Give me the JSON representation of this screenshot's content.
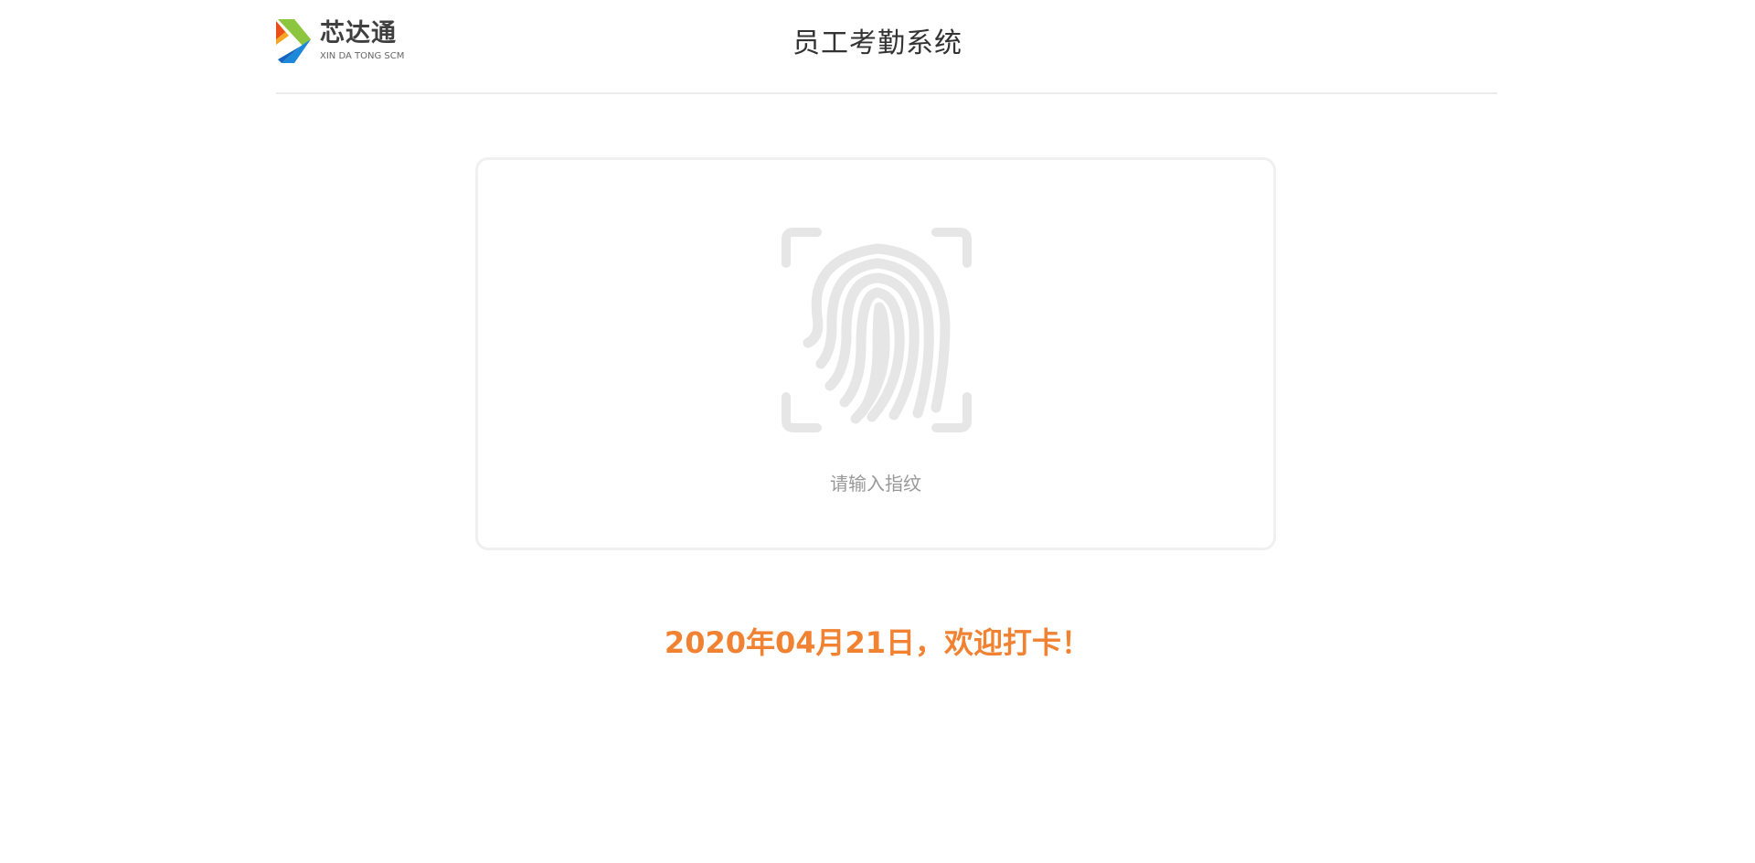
{
  "header": {
    "logo_cn": "芯达通",
    "logo_en": "XIN DA TONG SCM",
    "title": "员工考勤系统"
  },
  "scanner": {
    "icon": "fingerprint-icon",
    "prompt": "请输入指纹"
  },
  "welcome_message": "2020年04月21日，欢迎打卡！",
  "colors": {
    "accent": "#f08232",
    "fingerprint": "#e6e6e6",
    "prompt_text": "#999999",
    "divider": "#ececec"
  }
}
